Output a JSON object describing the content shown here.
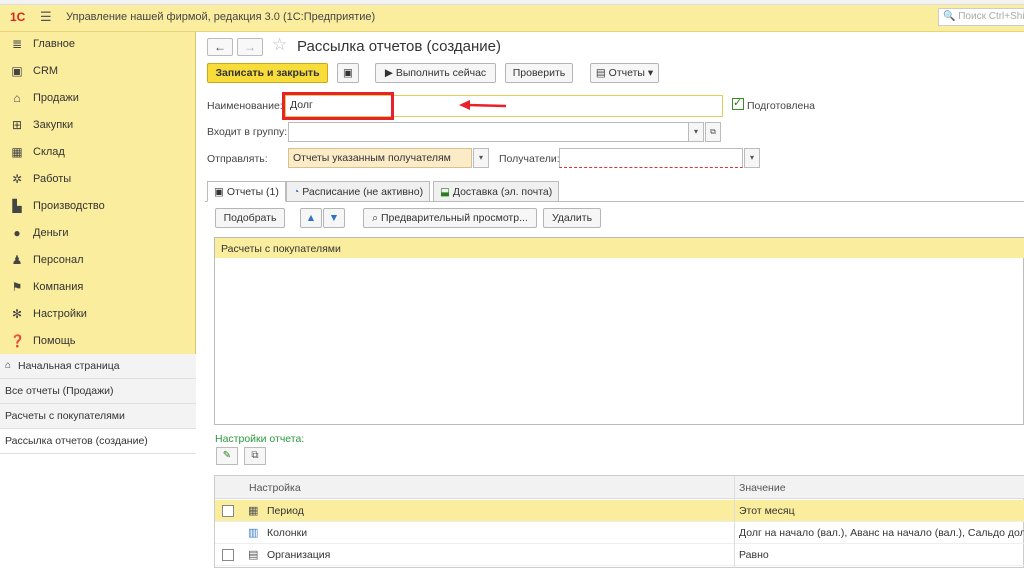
{
  "app": {
    "title": "Управление нашей фирмой, редакция 3.0  (1С:Предприятие)",
    "logo": "1С",
    "search_placeholder": "Поиск Ctrl+Shift+F"
  },
  "sidebar": {
    "items": [
      {
        "label": "Главное",
        "icon": "list-icon"
      },
      {
        "label": "CRM",
        "icon": "crm-icon"
      },
      {
        "label": "Продажи",
        "icon": "sales-icon"
      },
      {
        "label": "Закупки",
        "icon": "purchases-icon"
      },
      {
        "label": "Склад",
        "icon": "warehouse-icon"
      },
      {
        "label": "Работы",
        "icon": "works-icon"
      },
      {
        "label": "Производство",
        "icon": "production-icon"
      },
      {
        "label": "Деньги",
        "icon": "money-icon"
      },
      {
        "label": "Персонал",
        "icon": "staff-icon"
      },
      {
        "label": "Компания",
        "icon": "company-icon"
      },
      {
        "label": "Настройки",
        "icon": "settings-icon"
      },
      {
        "label": "Помощь",
        "icon": "help-icon"
      }
    ],
    "open_windows": [
      {
        "label": "Начальная страница"
      },
      {
        "label": "Все отчеты (Продажи)"
      },
      {
        "label": "Расчеты с покупателями"
      },
      {
        "label": "Рассылка отчетов (создание)"
      }
    ]
  },
  "form": {
    "title": "Рассылка отчетов (создание)",
    "toolbar": {
      "save_close": "Записать и закрыть",
      "run_now": "Выполнить сейчас",
      "check": "Проверить",
      "reports": "Отчеты"
    },
    "name_label": "Наименование:",
    "name_value": "Долг",
    "prepared_label": "Подготовлена",
    "prepared_checked": true,
    "group_label": "Входит в группу:",
    "group_value": "",
    "send_label": "Отправлять:",
    "send_value": "Отчеты указанным получателям",
    "recipients_label": "Получатели:",
    "recipients_value": ""
  },
  "tabs": [
    {
      "label": "Отчеты (1)",
      "icon": "report-icon"
    },
    {
      "label": "Расписание (не активно)",
      "icon": "clock-icon"
    },
    {
      "label": "Доставка (эл. почта)",
      "icon": "delivery-icon"
    }
  ],
  "reports_toolbar": {
    "pick": "Подобрать",
    "preview": "Предварительный просмотр...",
    "delete": "Удалить"
  },
  "reports_list": [
    "Расчеты с покупателями"
  ],
  "settings": {
    "label": "Настройки отчета:",
    "columns": {
      "setting": "Настройка",
      "value": "Значение"
    },
    "rows": [
      {
        "name": "Период",
        "value": "Этот месяц",
        "has_check": true,
        "icon": "calendar-icon"
      },
      {
        "name": "Колонки",
        "value": "Долг на начало (вал.), Аванс на начало (вал.), Сальдо долга",
        "has_check": false,
        "icon": "columns-icon"
      },
      {
        "name": "Организация",
        "value": "Равно",
        "has_check": true,
        "icon": "org-icon"
      }
    ]
  },
  "colors": {
    "accent_yellow": "#fbed9e",
    "primary_button": "#f7dc3a",
    "highlight_red": "#e8212b",
    "settings_green": "#2a9a3d"
  }
}
